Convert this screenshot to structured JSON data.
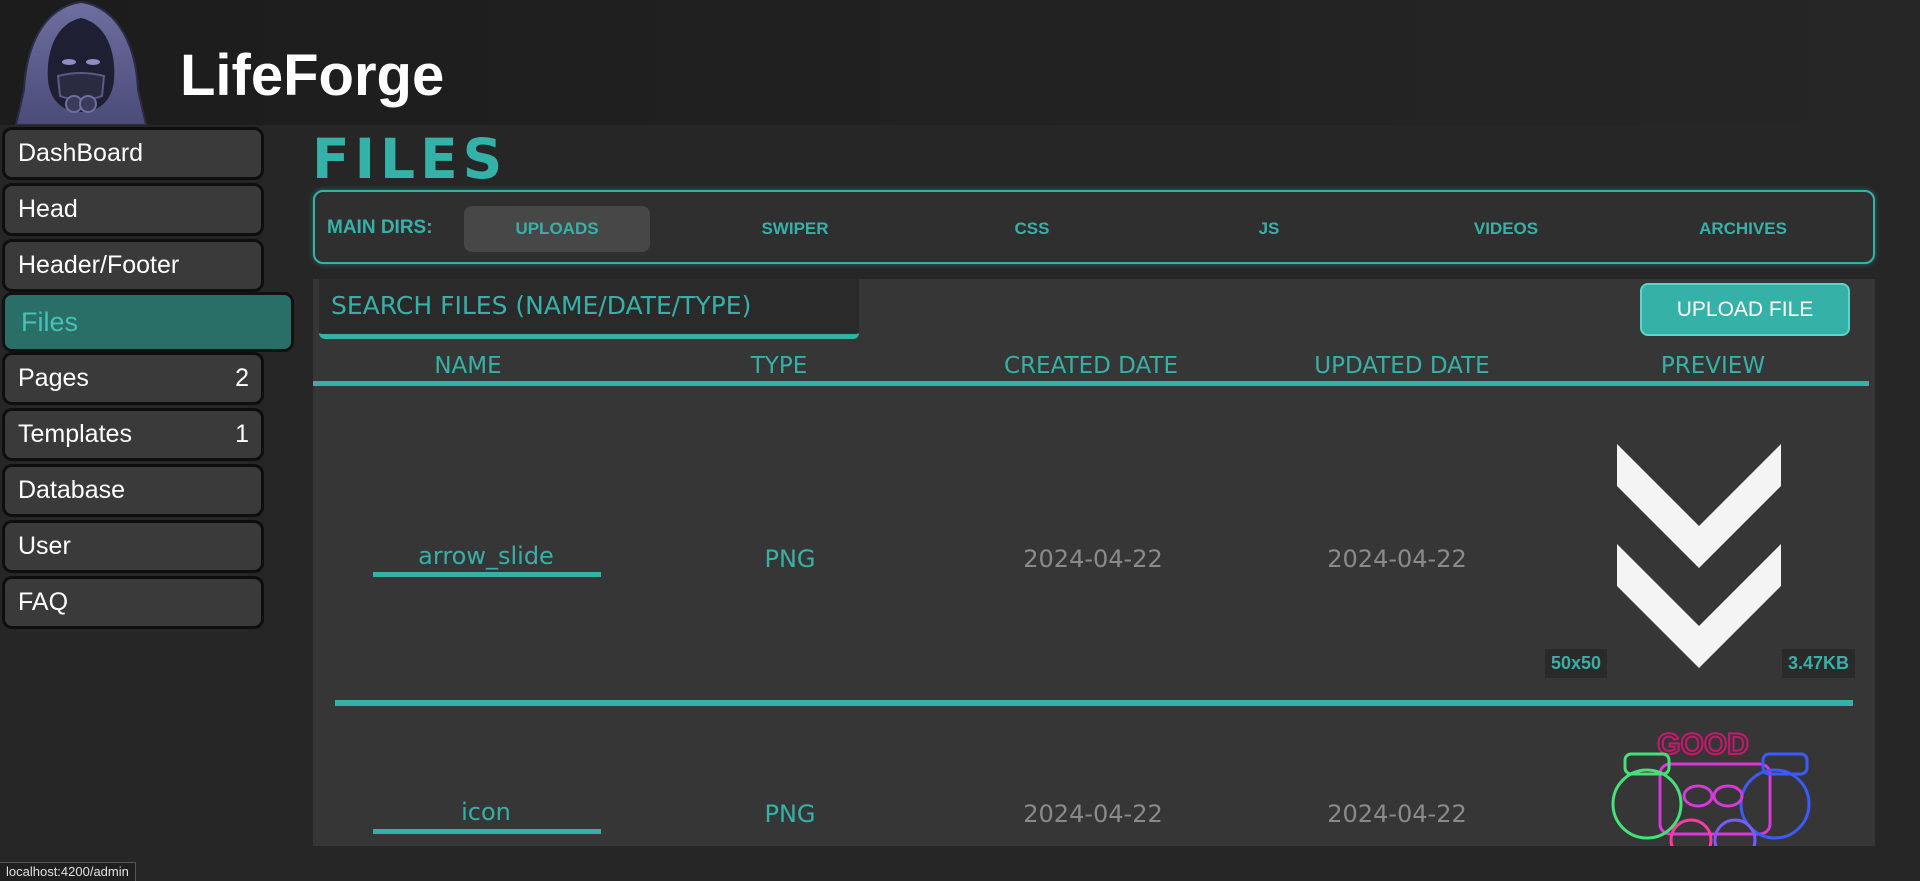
{
  "app": {
    "title": "LifeForge"
  },
  "sidebar": {
    "items": [
      {
        "label": "DashBoard",
        "count": ""
      },
      {
        "label": "Head",
        "count": ""
      },
      {
        "label": "Header/Footer",
        "count": ""
      },
      {
        "label": "Files",
        "count": ""
      },
      {
        "label": "Pages",
        "count": "2"
      },
      {
        "label": "Templates",
        "count": "1"
      },
      {
        "label": "Database",
        "count": ""
      },
      {
        "label": "User",
        "count": ""
      },
      {
        "label": "FAQ",
        "count": ""
      }
    ],
    "active": "Files"
  },
  "main": {
    "title": "FILES",
    "dirs_label": "MAIN DIRS:",
    "dirs": [
      "UPLOADS",
      "SWIPER",
      "CSS",
      "JS",
      "VIDEOS",
      "ARCHIVES"
    ],
    "active_dir": "UPLOADS",
    "search_placeholder": "SEARCH FILES (NAME/DATE/TYPE)",
    "upload_button": "UPLOAD FILE",
    "columns": [
      "NAME",
      "TYPE",
      "CREATED DATE",
      "UPDATED DATE",
      "PREVIEW"
    ],
    "rows": [
      {
        "name": "arrow_slide",
        "type": "PNG",
        "created": "2024-04-22",
        "updated": "2024-04-22",
        "dimensions": "50x50",
        "size": "3.47KB"
      },
      {
        "name": "icon",
        "type": "PNG",
        "created": "2024-04-22",
        "updated": "2024-04-22",
        "preview_text": "GOOD"
      }
    ]
  },
  "statusbar": {
    "url": "localhost:4200/admin"
  },
  "colors": {
    "accent": "#36b1a8",
    "background": "#262626",
    "panel": "#363636"
  }
}
